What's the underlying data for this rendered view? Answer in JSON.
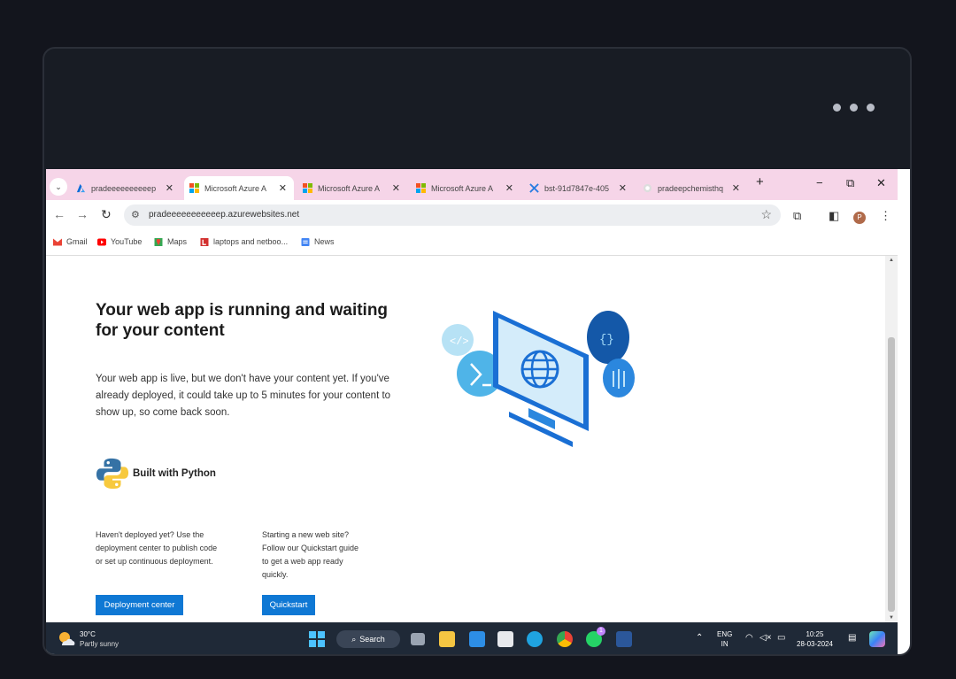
{
  "tabs": [
    {
      "title": "pradeeeeeeeeeep",
      "favicon": "azure-icon",
      "active": false
    },
    {
      "title": "Microsoft Azure A",
      "favicon": "microsoft-icon",
      "active": true
    },
    {
      "title": "Microsoft Azure A",
      "favicon": "microsoft-icon",
      "active": false
    },
    {
      "title": "Microsoft Azure A",
      "favicon": "microsoft-icon",
      "active": false
    },
    {
      "title": "bst-91d7847e-405",
      "favicon": "tool-icon",
      "active": false
    },
    {
      "title": "pradeepchemisthq",
      "favicon": "github-icon",
      "active": false
    }
  ],
  "window": {
    "minimize": "−",
    "restore": "⧉",
    "close": "✕",
    "new_tab": "+",
    "tab_close": "✕",
    "tab_list": "⌄"
  },
  "address": {
    "url": "pradeeeeeeeeeeep.azurewebsites.net"
  },
  "bookmarks": [
    "Gmail",
    "YouTube",
    "Maps",
    "laptops and netboo...",
    "News"
  ],
  "page": {
    "heading": "Your web app is running and waiting for your content",
    "description": "Your web app is live, but we don't have your content yet. If you've already deployed, it could take up to 5 minutes for your content to show up, so come back soon.",
    "built_with": "Built with Python",
    "left_col": "Haven't deployed yet? Use the deployment center to publish code or set up continuous deployment.",
    "right_col": "Starting a new web site? Follow our Quickstart guide to get a web app ready quickly.",
    "deployment_button": "Deployment center",
    "quickstart_button": "Quickstart"
  },
  "taskbar": {
    "temperature": "30°C",
    "weather": "Partly sunny",
    "search": "Search",
    "lang_1": "ENG",
    "lang_2": "IN",
    "time": "10:25",
    "date": "28-03-2024",
    "whatsapp_badge": "1"
  },
  "colors": {
    "accent": "#0f78d4",
    "tab_strip": "#f6d5e8",
    "taskbar": "#1f2937"
  }
}
